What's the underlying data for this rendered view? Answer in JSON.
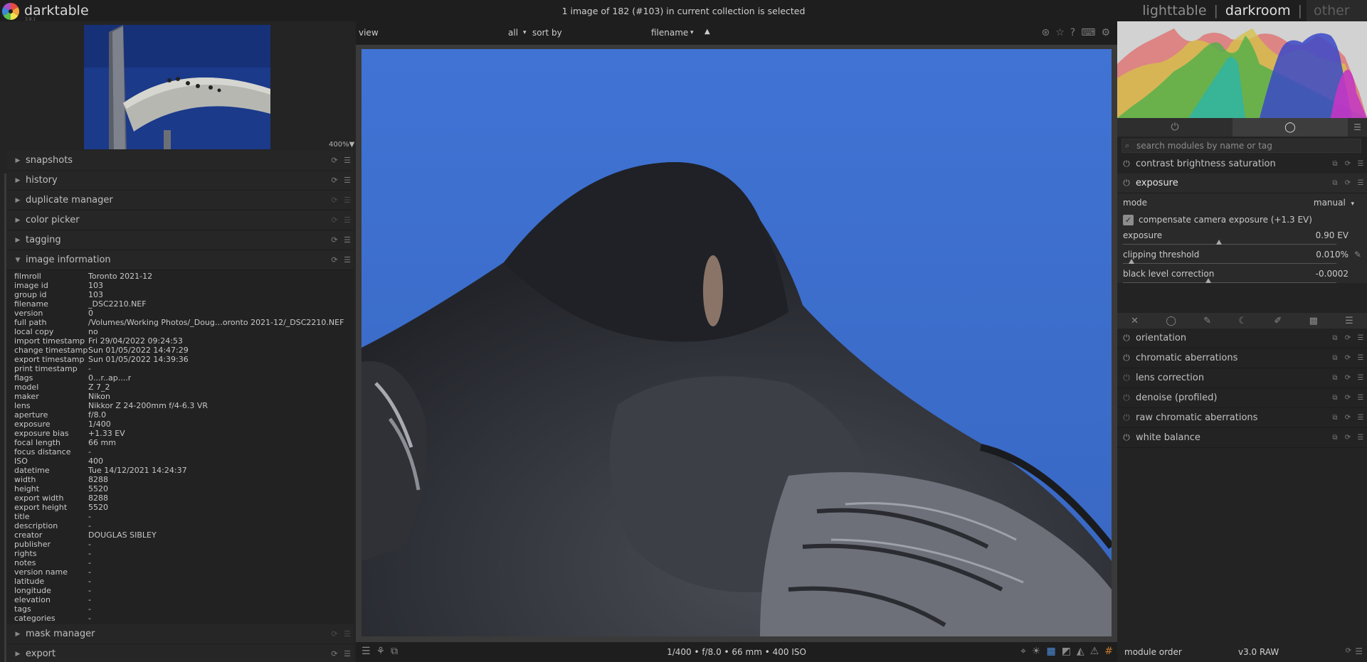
{
  "app": {
    "name": "darktable",
    "version_tag": "3.8.1"
  },
  "selection_status": "1 image of 182 (#103) in current collection is selected",
  "views": {
    "lighttable": "lighttable",
    "separator": "|",
    "darkroom": "darkroom",
    "other": "other"
  },
  "navigator": {
    "zoom": "400%▼"
  },
  "left_modules": [
    {
      "label": "snapshots"
    },
    {
      "label": "history"
    },
    {
      "label": "duplicate manager"
    },
    {
      "label": "color picker"
    },
    {
      "label": "tagging"
    },
    {
      "label": "image information"
    }
  ],
  "image_info": [
    {
      "k": "filmroll",
      "v": "Toronto 2021-12"
    },
    {
      "k": "image id",
      "v": "103"
    },
    {
      "k": "group id",
      "v": "103"
    },
    {
      "k": "filename",
      "v": "_DSC2210.NEF"
    },
    {
      "k": "version",
      "v": "0"
    },
    {
      "k": "full path",
      "v": "/Volumes/Working Photos/_Doug…oronto 2021-12/_DSC2210.NEF"
    },
    {
      "k": "local copy",
      "v": "no"
    },
    {
      "k": "import timestamp",
      "v": "Fri 29/04/2022 09:24:53"
    },
    {
      "k": "change timestamp",
      "v": "Sun 01/05/2022 14:47:29"
    },
    {
      "k": "export timestamp",
      "v": "Sun 01/05/2022 14:39:36"
    },
    {
      "k": "print timestamp",
      "v": "-"
    },
    {
      "k": "flags",
      "v": "0...r..ap....r"
    },
    {
      "k": "model",
      "v": "Z 7_2"
    },
    {
      "k": "maker",
      "v": "Nikon"
    },
    {
      "k": "lens",
      "v": "Nikkor Z 24-200mm f/4-6.3 VR"
    },
    {
      "k": "aperture",
      "v": "f/8.0"
    },
    {
      "k": "exposure",
      "v": "1/400"
    },
    {
      "k": "exposure bias",
      "v": "+1.33 EV"
    },
    {
      "k": "focal length",
      "v": "66 mm"
    },
    {
      "k": "focus distance",
      "v": "-"
    },
    {
      "k": "ISO",
      "v": "400"
    },
    {
      "k": "datetime",
      "v": "Tue 14/12/2021 14:24:37"
    },
    {
      "k": "width",
      "v": "8288"
    },
    {
      "k": "height",
      "v": "5520"
    },
    {
      "k": "export width",
      "v": "8288"
    },
    {
      "k": "export height",
      "v": "5520"
    },
    {
      "k": "title",
      "v": "-"
    },
    {
      "k": "description",
      "v": "-"
    },
    {
      "k": "creator",
      "v": "DOUGLAS SIBLEY"
    },
    {
      "k": "publisher",
      "v": "-"
    },
    {
      "k": "rights",
      "v": "-"
    },
    {
      "k": "notes",
      "v": "-"
    },
    {
      "k": "version name",
      "v": "-"
    },
    {
      "k": "latitude",
      "v": "-"
    },
    {
      "k": "longitude",
      "v": "-"
    },
    {
      "k": "elevation",
      "v": "-"
    },
    {
      "k": "tags",
      "v": "-"
    },
    {
      "k": "categories",
      "v": "-"
    }
  ],
  "left_modules_bottom": [
    {
      "label": "mask manager"
    },
    {
      "label": "export"
    }
  ],
  "filterbar": {
    "view": "view",
    "all": "all",
    "sort_by": "sort by",
    "filename": "filename",
    "dropdown_caret": "▾",
    "sort_dir": "▲"
  },
  "bottombar": {
    "exif": "1/400 • f/8.0 • 66 mm • 400 ISO"
  },
  "right_panel": {
    "search_placeholder": "search modules by name or tag",
    "modules_top": [
      {
        "label": "contrast brightness saturation",
        "on": true
      },
      {
        "label": "exposure",
        "on": true
      }
    ],
    "exposure": {
      "mode_label": "mode",
      "mode_value": "manual",
      "mode_caret": "▾",
      "compensate": "compensate camera exposure (+1.3 EV)",
      "exposure_label": "exposure",
      "exposure_value": "0.90 EV",
      "exposure_pos": 0.45,
      "clipping_label": "clipping threshold",
      "clipping_value": "0.010%",
      "clipping_pos": 0.04,
      "black_label": "black level correction",
      "black_value": "-0.0002",
      "black_pos": 0.4
    },
    "modules_bottom": [
      {
        "label": "orientation",
        "on": true
      },
      {
        "label": "chromatic aberrations",
        "on": true
      },
      {
        "label": "lens correction",
        "on": false
      },
      {
        "label": "denoise (profiled)",
        "on": false
      },
      {
        "label": "raw chromatic aberrations",
        "on": false
      },
      {
        "label": "white balance",
        "on": true
      }
    ],
    "module_order_label": "module order",
    "module_order_value": "v3.0 RAW"
  },
  "colors": {
    "accent": "#e0e0e0",
    "sky": "#3f6fd0",
    "panel": "#242424"
  }
}
